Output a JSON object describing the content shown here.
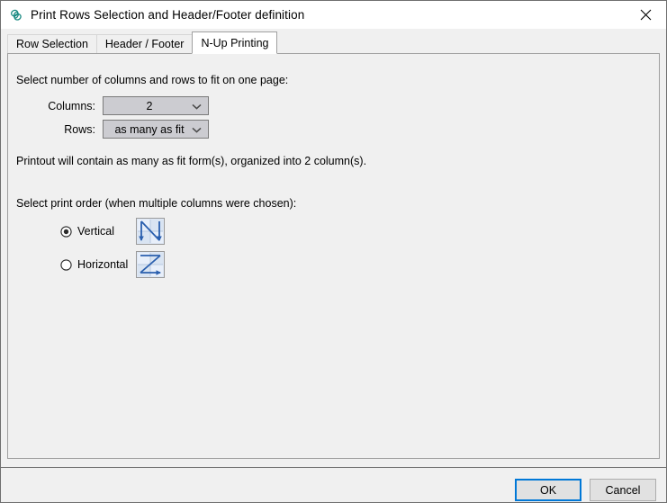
{
  "window": {
    "title": "Print Rows Selection and Header/Footer definition",
    "icon": "app-logo-icon",
    "close_label": "✕",
    "accent_color": "#0078d7",
    "icon_color": "#1a8a82"
  },
  "tabs": [
    {
      "label": "Row Selection",
      "selected": false
    },
    {
      "label": "Header / Footer",
      "selected": false
    },
    {
      "label": "N-Up Printing",
      "selected": true
    }
  ],
  "nup": {
    "intro": "Select number of columns and rows to fit on one page:",
    "columns_label": "Columns:",
    "columns_value": "2",
    "rows_label": "Rows:",
    "rows_value": "as many as fit",
    "summary": "Printout will contain as many as fit form(s), organized into 2 column(s).",
    "order_heading": "Select print order (when multiple columns were chosen):",
    "order_options": [
      {
        "label": "Vertical",
        "selected": true,
        "preview_icon": "vertical-order-icon"
      },
      {
        "label": "Horizontal",
        "selected": false,
        "preview_icon": "horizontal-order-icon"
      }
    ]
  },
  "footer": {
    "ok_label": "OK",
    "cancel_label": "Cancel"
  }
}
